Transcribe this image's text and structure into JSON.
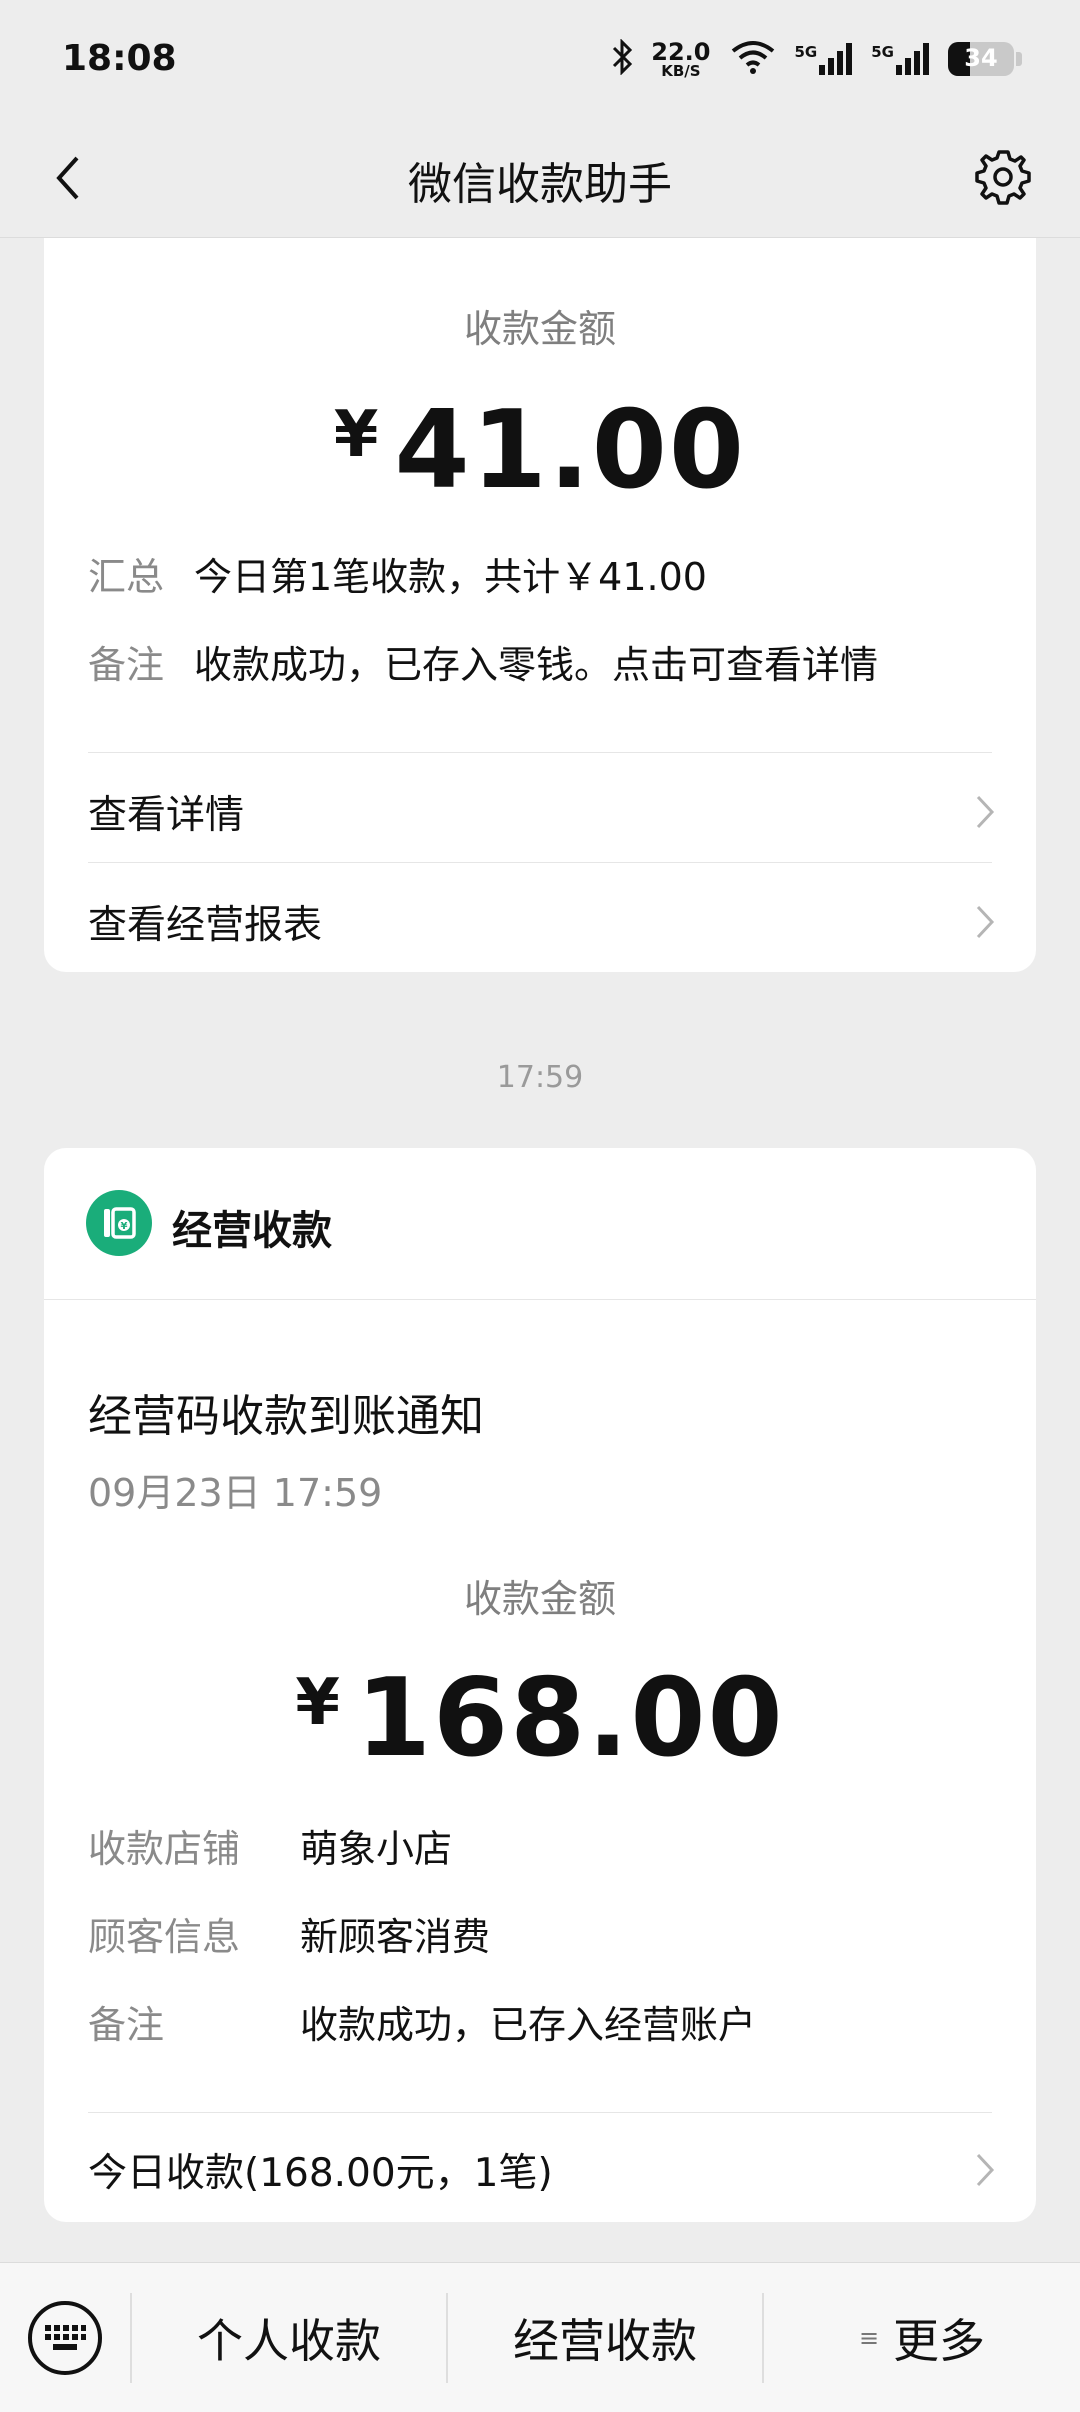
{
  "status_bar": {
    "time": "18:08",
    "net_speed_value": "22.0",
    "net_speed_unit": "KB/S",
    "signal1": "5G",
    "signal2": "5G",
    "battery_level": "34",
    "battery_fraction": 0.34
  },
  "nav": {
    "title": "微信收款助手",
    "back_icon": "chevron-left-icon",
    "settings_icon": "gear-icon"
  },
  "card1": {
    "amount_label": "收款金额",
    "currency": "¥",
    "amount": "41.00",
    "summary_key": "汇总",
    "summary_value": "今日第1笔收款，共计￥41.00",
    "note_key": "备注",
    "note_value": "收款成功，已存入零钱。点击可查看详情",
    "links": [
      "查看详情",
      "查看经营报表"
    ]
  },
  "timestamp": "17:59",
  "card2": {
    "brand_name": "经营收款",
    "notice_title": "经营码收款到账通知",
    "notice_date": "09月23日 17:59",
    "amount_label": "收款金额",
    "currency": "¥",
    "amount": "168.00",
    "rows": [
      {
        "key": "收款店铺",
        "value": "萌象小店"
      },
      {
        "key": "顾客信息",
        "value": "新顾客消费"
      },
      {
        "key": "备注",
        "value": "收款成功，已存入经营账户"
      }
    ],
    "footer_link": "今日收款(168.00元，1笔)"
  },
  "bottom_bar": {
    "keyboard_icon": "keyboard-icon",
    "tabs": [
      "个人收款",
      "经营收款",
      "更多"
    ],
    "more_icon": "≡"
  },
  "colors": {
    "background": "#ededed",
    "card": "#ffffff",
    "brand_green": "#1aad7a",
    "secondary_text": "#8a8a8a"
  }
}
